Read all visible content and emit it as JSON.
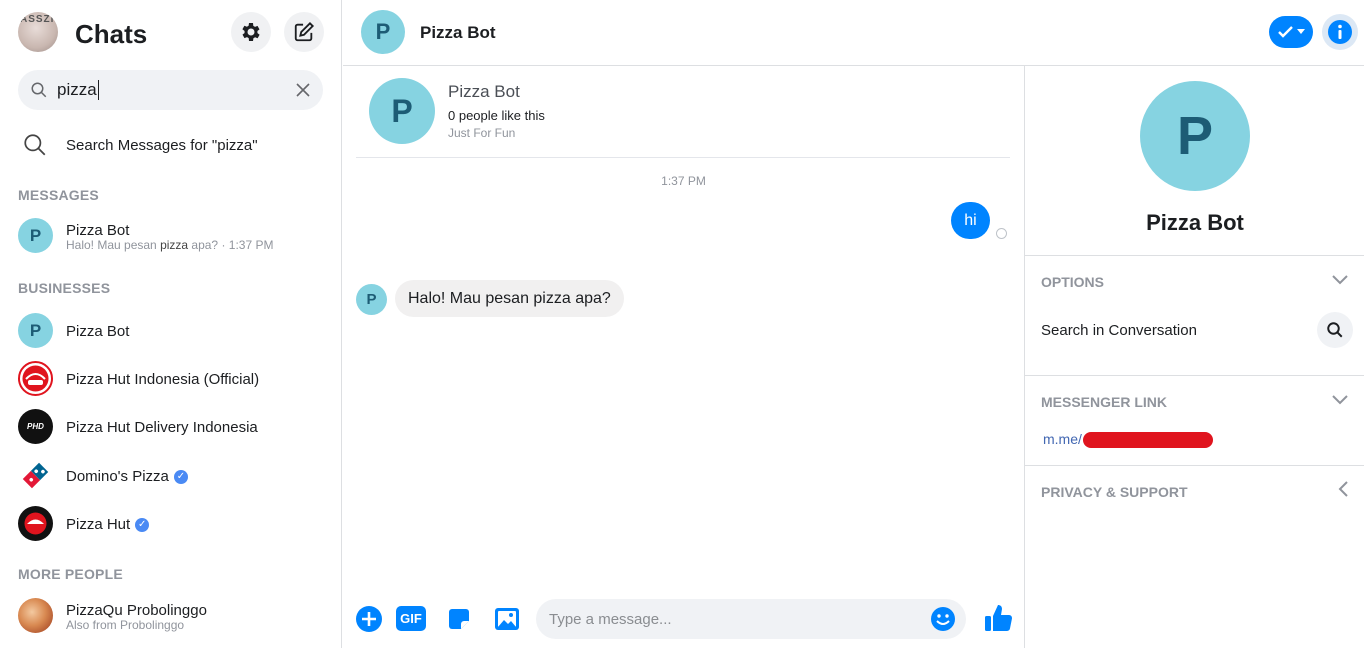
{
  "sidebar": {
    "title": "Chats",
    "profile_avatar_text": "ASSZI",
    "search": {
      "value": "pizza"
    },
    "search_messages_label": "Search Messages for \"pizza\"",
    "sections": {
      "messages": "MESSAGES",
      "businesses": "BUSINESSES",
      "more_people": "MORE PEOPLE"
    },
    "messages": [
      {
        "name": "Pizza Bot",
        "preview_before": "Halo! Mau pesan ",
        "preview_bold": "pizza",
        "preview_after": " apa? · 1:37 PM",
        "initial": "P"
      }
    ],
    "businesses": [
      {
        "name": "Pizza Bot",
        "initial": "P",
        "verified": false
      },
      {
        "name": "Pizza Hut Indonesia (Official)",
        "verified": false
      },
      {
        "name": "Pizza Hut Delivery Indonesia",
        "avatar_text": "PHD",
        "verified": false
      },
      {
        "name": "Domino's Pizza",
        "verified": true
      },
      {
        "name": "Pizza Hut",
        "verified": true
      }
    ],
    "more_people": [
      {
        "name": "PizzaQu Probolinggo",
        "sub": "Also from Probolinggo"
      }
    ]
  },
  "chat": {
    "header_title": "Pizza Bot",
    "header_initial": "P",
    "profile": {
      "name": "Pizza Bot",
      "likes": "0 people like this",
      "category": "Just For Fun",
      "initial": "P"
    },
    "timestamp": "1:37 PM",
    "outgoing": "hi",
    "incoming": "Halo! Mau pesan pizza apa?",
    "composer_placeholder": "Type a message...",
    "composer_gif_label": "GIF"
  },
  "info": {
    "initial": "P",
    "name": "Pizza Bot",
    "options_label": "OPTIONS",
    "search_in_conversation": "Search in Conversation",
    "messenger_link_label": "MESSENGER LINK",
    "messenger_link_prefix": "m.me/",
    "privacy_label": "PRIVACY & SUPPORT"
  },
  "colors": {
    "accent": "#0084ff",
    "avatar_bg": "#86d3e1",
    "avatar_fg": "#1d5c75",
    "redaction": "#e0141e"
  }
}
